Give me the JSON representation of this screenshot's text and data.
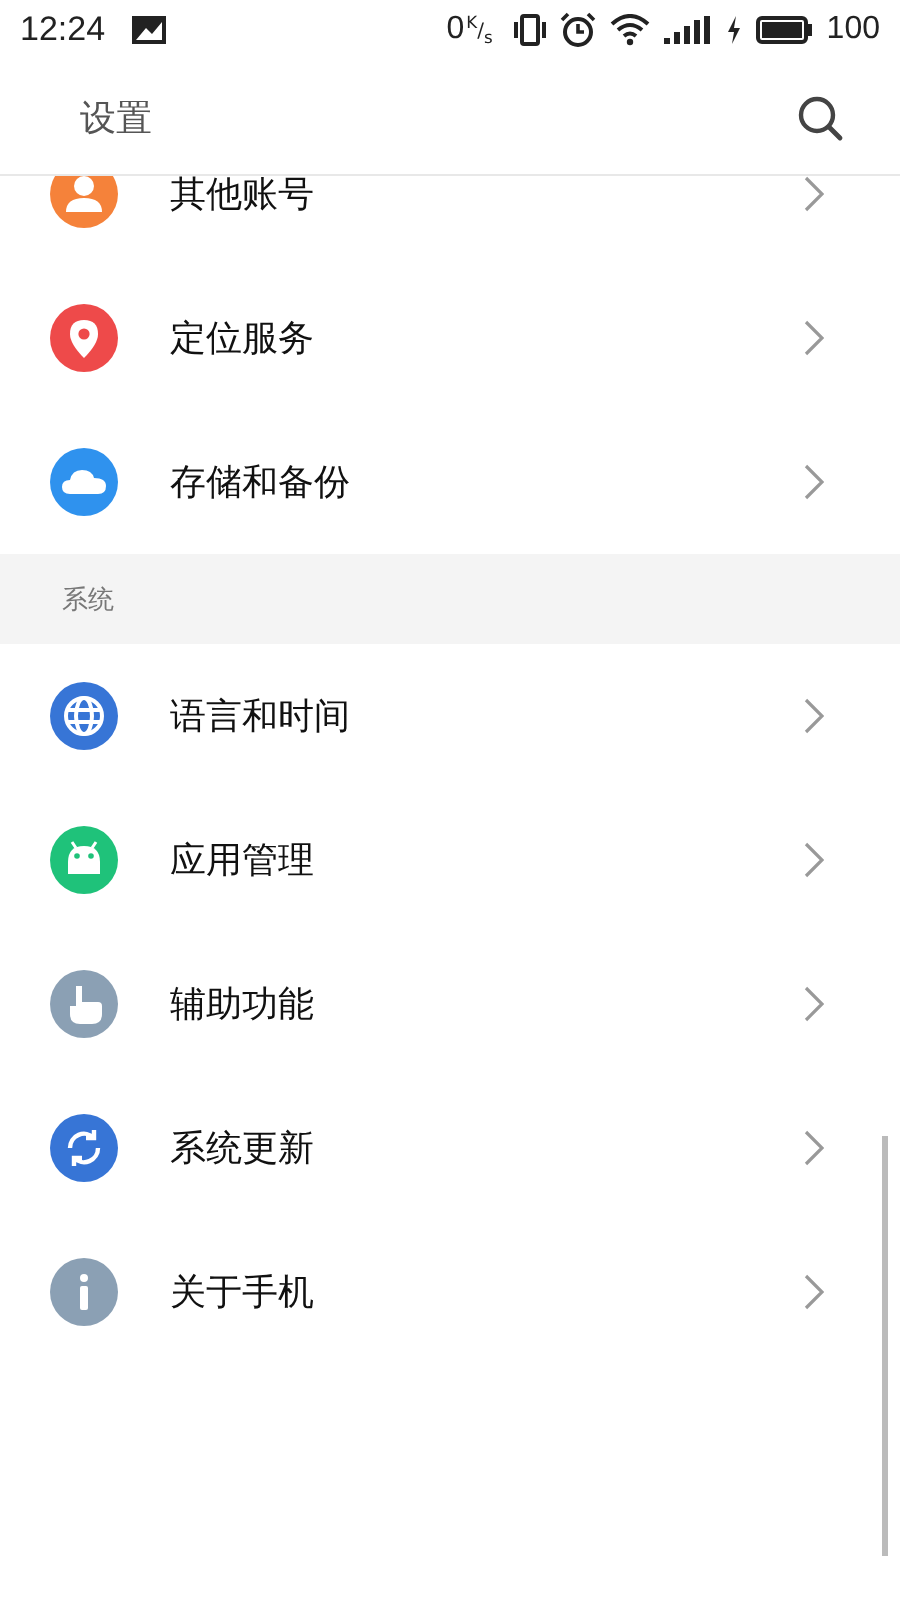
{
  "status_bar": {
    "time": "12:24",
    "net_speed": "0",
    "net_unit": "$^{K}$/$_{s}$",
    "battery": "100"
  },
  "header": {
    "title": "设置"
  },
  "sections": [
    {
      "items": [
        {
          "label": "其他账号",
          "kind": "person",
          "color": "#f5823a"
        },
        {
          "label": "定位服务",
          "kind": "location",
          "color": "#ee4a4a"
        },
        {
          "label": "存储和备份",
          "kind": "cloud",
          "color": "#2f92ee"
        }
      ]
    },
    {
      "title": "系统",
      "items": [
        {
          "label": "语言和时间",
          "kind": "globe",
          "color": "#3775d6"
        },
        {
          "label": "应用管理",
          "kind": "android",
          "color": "#1fc27a"
        },
        {
          "label": "辅助功能",
          "kind": "hand",
          "color": "#8ba0b4"
        },
        {
          "label": "系统更新",
          "kind": "sync",
          "color": "#3775d6"
        },
        {
          "label": "关于手机",
          "kind": "info",
          "color": "#8ba0b4"
        }
      ]
    }
  ]
}
